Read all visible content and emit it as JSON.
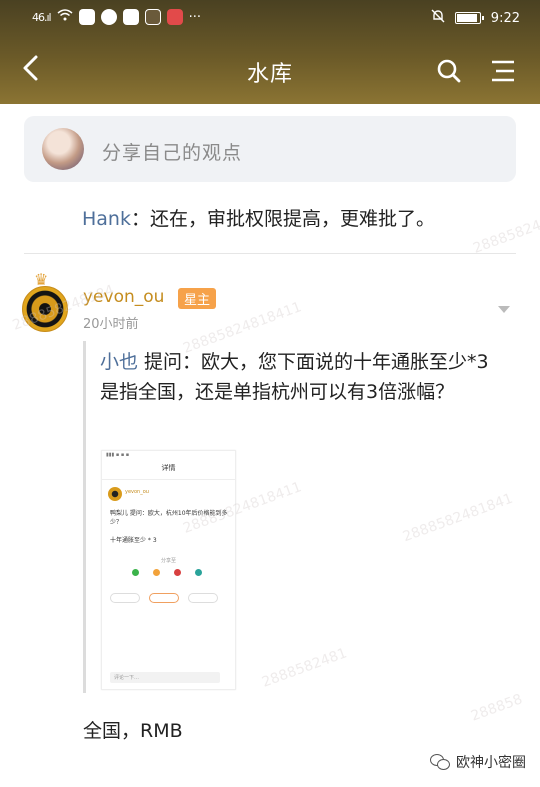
{
  "status_bar": {
    "signal": "46.ıl",
    "time": "9:22"
  },
  "header": {
    "title": "水库",
    "back_icon": "chevron-left-icon",
    "search_icon": "search-icon",
    "menu_icon": "menu-icon"
  },
  "share_box": {
    "placeholder": "分享自己的观点"
  },
  "reply": {
    "author": "Hank",
    "text": "：还在，审批权限提高，更难批了。"
  },
  "post": {
    "username": "yevon_ou",
    "badge": "星主",
    "time": "20小时前",
    "quote": {
      "asker": "小也",
      "text": "提问：欧大，您下面说的十年通胀至少*3是指全国，还是单指杭州可以有3倍涨幅？"
    },
    "screenshot": {
      "title": "详情",
      "username": "yevon_ou",
      "question": "鸭梨儿 提问：欧大，杭州10年后价格能到多少？",
      "answer": "十年通胀至少 * 3",
      "share_label": "分享至",
      "input_placeholder": "评论一下…"
    },
    "answer": "全国，RMB"
  },
  "brand_watermark": "欧神小密圈",
  "watermarks": [
    "28885824818411",
    "288858248184",
    "28885824818411",
    "28885824818411",
    "2888582481841",
    "2888582481",
    "288858"
  ]
}
